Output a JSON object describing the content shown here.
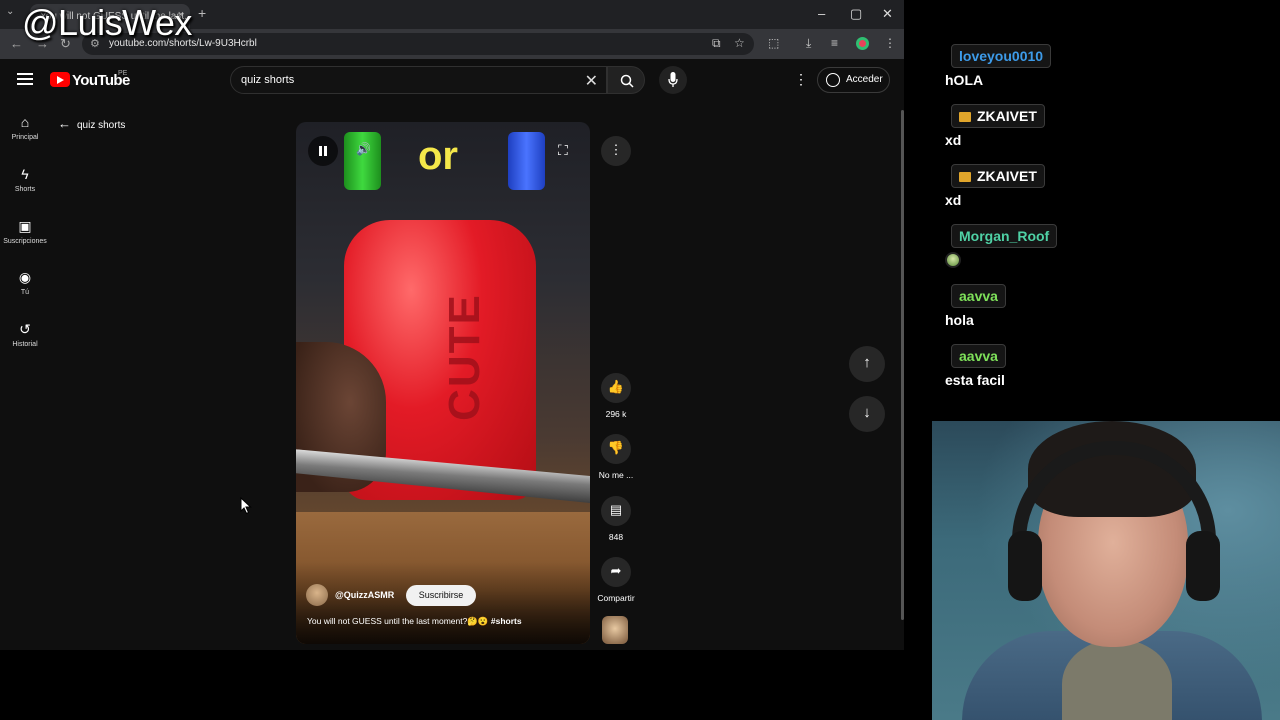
{
  "watermark": "@LuisWex",
  "browser": {
    "tab_title": "You will not GUESS until the last...",
    "tab_close": "×",
    "new_tab": "+",
    "url": "youtube.com/shorts/Lw-9U3Hcrbl"
  },
  "youtube": {
    "logo_text": "YouTube",
    "country": "PE",
    "search_value": "quiz shorts",
    "sign_in": "Acceder",
    "guide": [
      {
        "label": "Principal",
        "icon": "home-icon"
      },
      {
        "label": "Shorts",
        "icon": "shorts-icon"
      },
      {
        "label": "Suscripciones",
        "icon": "subscriptions-icon"
      },
      {
        "label": "Tú",
        "icon": "you-icon"
      },
      {
        "label": "Historial",
        "icon": "history-icon"
      }
    ],
    "back_label": "quiz shorts"
  },
  "short": {
    "overlay_text": "or",
    "channel": "@QuizzASMR",
    "subscribe": "Suscribirse",
    "caption": "You will not GUESS until the last moment?🤔😮 ",
    "hashtag": "#shorts",
    "soap_text": "CUTE",
    "actions": {
      "likes": "296 k",
      "dislike": "No me ...",
      "comments": "848",
      "share": "Compartir"
    }
  },
  "chat": [
    {
      "user": "loveyou0010",
      "color": "#3d9be9",
      "badge": false,
      "message": "hOLA"
    },
    {
      "user": "ZKAIVET",
      "color": "#ffffff",
      "badge": true,
      "message": "xd"
    },
    {
      "user": "ZKAIVET",
      "color": "#ffffff",
      "badge": true,
      "message": "xd"
    },
    {
      "user": "Morgan_Roof",
      "color": "#4fd1a5",
      "badge": false,
      "message": ""
    },
    {
      "user": "aavva",
      "color": "#7ee05a",
      "badge": false,
      "message": "hola"
    },
    {
      "user": "aavva",
      "color": "#7ee05a",
      "badge": false,
      "message": "esta facil"
    }
  ],
  "colors": {
    "yt_red": "#ff0000",
    "overlay_text": "#f5e84a",
    "page_bg": "#0f0f0f"
  }
}
